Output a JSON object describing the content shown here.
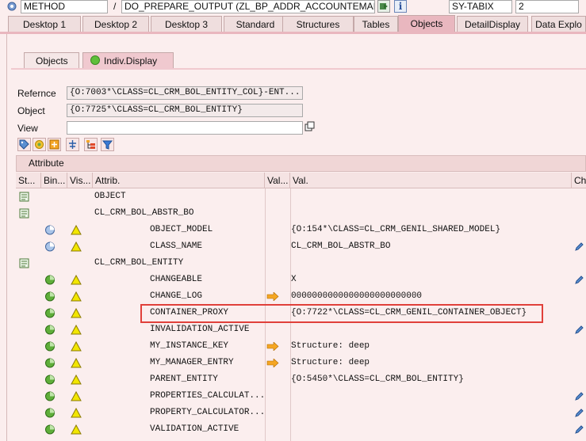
{
  "topbar": {
    "kind_value": "METHOD",
    "slash": "/",
    "method_value": "DO_PREPARE_OUTPUT (ZL_BP_ADDR_ACCOUNTEMAIL...",
    "var_value": "SY-TABIX",
    "var_result": "2"
  },
  "tabs": [
    "Desktop 1",
    "Desktop 2",
    "Desktop 3",
    "Standard",
    "Structures",
    "Tables",
    "Objects",
    "DetailDisplay",
    "Data Explo"
  ],
  "active_tab": "Objects",
  "subtabs": [
    "Objects",
    "Indiv.Display"
  ],
  "active_subtab": "Indiv.Display",
  "form": {
    "reference_label": "Refernce",
    "reference_value": "{O:7003*\\CLASS=CL_CRM_BOL_ENTITY_COL}-ENT...",
    "object_label": "Object",
    "object_value": "{O:7725*\\CLASS=CL_CRM_BOL_ENTITY}",
    "view_label": "View",
    "view_value": ""
  },
  "toolbar_icons": [
    "tag-icon",
    "refresh-icon",
    "expand-icon",
    "tree-icon",
    "hierarchy-icon",
    "filter-icon"
  ],
  "section_title": "Attribute",
  "columns": [
    "St...",
    "Bin...",
    "Vis...",
    "Attrib.",
    "Val...",
    "Val.",
    "Ch"
  ],
  "rows": [
    {
      "status": "class",
      "binding": "",
      "visibility": "",
      "attrib": "OBJECT",
      "arrow": false,
      "value": "",
      "edit": false
    },
    {
      "status": "class",
      "binding": "",
      "visibility": "",
      "attrib": "CL_CRM_BOL_ABSTR_BO",
      "arrow": false,
      "value": "",
      "edit": false
    },
    {
      "status": "",
      "binding": "instance",
      "visibility": "warn",
      "attrib": "OBJECT_MODEL",
      "arrow": false,
      "value": "{O:154*\\CLASS=CL_CRM_GENIL_SHARED_MODEL}",
      "edit": false
    },
    {
      "status": "",
      "binding": "instance",
      "visibility": "warn",
      "attrib": "CLASS_NAME",
      "arrow": false,
      "value": "CL_CRM_BOL_ABSTR_BO",
      "edit": true
    },
    {
      "status": "class",
      "binding": "",
      "visibility": "",
      "attrib": "CL_CRM_BOL_ENTITY",
      "arrow": false,
      "value": "",
      "edit": false
    },
    {
      "status": "",
      "binding": "green",
      "visibility": "warn",
      "attrib": "CHANGEABLE",
      "arrow": false,
      "value": "X",
      "edit": true
    },
    {
      "status": "",
      "binding": "green",
      "visibility": "warn",
      "attrib": "CHANGE_LOG",
      "arrow": true,
      "value": "0000000000000000000000000",
      "edit": false
    },
    {
      "status": "",
      "binding": "green",
      "visibility": "warn",
      "attrib": "CONTAINER_PROXY",
      "arrow": false,
      "value": "{O:7722*\\CLASS=CL_CRM_GENIL_CONTAINER_OBJECT}",
      "edit": false,
      "highlight": true
    },
    {
      "status": "",
      "binding": "green",
      "visibility": "warn",
      "attrib": "INVALIDATION_ACTIVE",
      "arrow": false,
      "value": "",
      "edit": true
    },
    {
      "status": "",
      "binding": "green",
      "visibility": "warn",
      "attrib": "MY_INSTANCE_KEY",
      "arrow": true,
      "value": "Structure: deep",
      "edit": false
    },
    {
      "status": "",
      "binding": "green",
      "visibility": "warn",
      "attrib": "MY_MANAGER_ENTRY",
      "arrow": true,
      "value": "Structure: deep",
      "edit": false
    },
    {
      "status": "",
      "binding": "green",
      "visibility": "warn",
      "attrib": "PARENT_ENTITY",
      "arrow": false,
      "value": "{O:5450*\\CLASS=CL_CRM_BOL_ENTITY}",
      "edit": false
    },
    {
      "status": "",
      "binding": "green",
      "visibility": "warn",
      "attrib": "PROPERTIES_CALCULAT...",
      "arrow": false,
      "value": "",
      "edit": true
    },
    {
      "status": "",
      "binding": "green",
      "visibility": "warn",
      "attrib": "PROPERTY_CALCULATOR...",
      "arrow": false,
      "value": "",
      "edit": true
    },
    {
      "status": "",
      "binding": "green",
      "visibility": "warn",
      "attrib": "VALIDATION_ACTIVE",
      "arrow": false,
      "value": "",
      "edit": true
    }
  ],
  "colors": {
    "highlight_box": "#e0403a",
    "tab_active": "#e9b7bf",
    "background": "#fbeeee",
    "warn": "#f2e600",
    "arrow": "#f0a020"
  }
}
